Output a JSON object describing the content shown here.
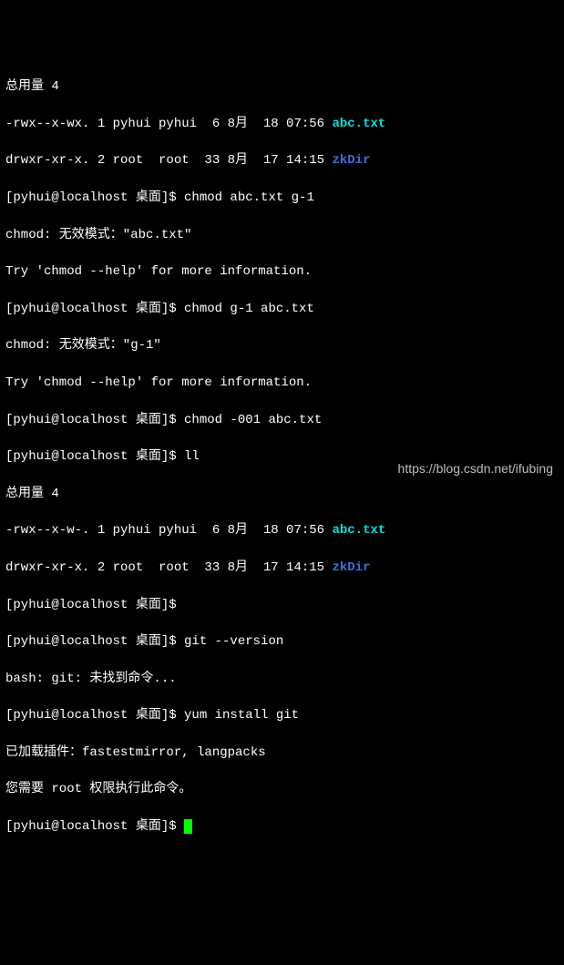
{
  "term": {
    "l1": "总用量 4",
    "l2a": "-rwx--x-wx. 1 pyhui pyhui  6 8月  18 07:56 ",
    "l2b": "abc.txt",
    "l3a": "drwxr-xr-x. 2 root  root  33 8月  17 14:15 ",
    "l3b": "zkDir",
    "l4": "[pyhui@localhost 桌面]$ chmod abc.txt g-1",
    "l5": "chmod: 无效模式：\"abc.txt\"",
    "l6": "Try 'chmod --help' for more information.",
    "l7": "[pyhui@localhost 桌面]$ chmod g-1 abc.txt",
    "l8": "chmod: 无效模式：\"g-1\"",
    "l9": "Try 'chmod --help' for more information.",
    "l10": "[pyhui@localhost 桌面]$ chmod -001 abc.txt",
    "l11": "[pyhui@localhost 桌面]$ ll",
    "l12": "总用量 4",
    "l13a": "-rwx--x-w-. 1 pyhui pyhui  6 8月  18 07:56 ",
    "l13b": "abc.txt",
    "l14a": "drwxr-xr-x. 2 root  root  33 8月  17 14:15 ",
    "l14b": "zkDir",
    "l15": "[pyhui@localhost 桌面]$ ",
    "l16": "[pyhui@localhost 桌面]$ git --version",
    "l17": "bash: git: 未找到命令...",
    "l18": "[pyhui@localhost 桌面]$ yum install git",
    "l19": "已加载插件：fastestmirror, langpacks",
    "l20": "您需要 root 权限执行此命令。",
    "l21": "[pyhui@localhost 桌面]$ "
  },
  "watermark": "https://blog.csdn.net/ifubing"
}
